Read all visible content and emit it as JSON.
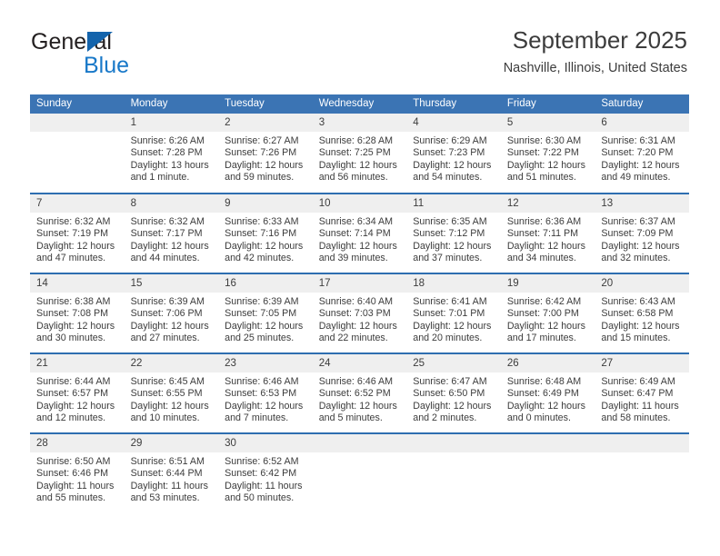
{
  "brand": {
    "word_general": "General",
    "word_blue": "Blue",
    "triangle_color": "#1464ac",
    "blue_text_color": "#1878c8"
  },
  "header": {
    "title": "September 2025",
    "subtitle": "Nashville, Illinois, United States"
  },
  "colors": {
    "header_row_bg": "#3b74b4",
    "row_divider": "#2e6eb0",
    "daynum_bg": "#efefef",
    "text": "#3c3c3c"
  },
  "columns": [
    "Sunday",
    "Monday",
    "Tuesday",
    "Wednesday",
    "Thursday",
    "Friday",
    "Saturday"
  ],
  "weeks": [
    [
      {
        "day": "",
        "blank": true,
        "sunrise": "",
        "sunset": "",
        "daylight_line1": "",
        "daylight_line2": ""
      },
      {
        "day": "1",
        "sunrise": "Sunrise: 6:26 AM",
        "sunset": "Sunset: 7:28 PM",
        "daylight_line1": "Daylight: 13 hours",
        "daylight_line2": "and 1 minute."
      },
      {
        "day": "2",
        "sunrise": "Sunrise: 6:27 AM",
        "sunset": "Sunset: 7:26 PM",
        "daylight_line1": "Daylight: 12 hours",
        "daylight_line2": "and 59 minutes."
      },
      {
        "day": "3",
        "sunrise": "Sunrise: 6:28 AM",
        "sunset": "Sunset: 7:25 PM",
        "daylight_line1": "Daylight: 12 hours",
        "daylight_line2": "and 56 minutes."
      },
      {
        "day": "4",
        "sunrise": "Sunrise: 6:29 AM",
        "sunset": "Sunset: 7:23 PM",
        "daylight_line1": "Daylight: 12 hours",
        "daylight_line2": "and 54 minutes."
      },
      {
        "day": "5",
        "sunrise": "Sunrise: 6:30 AM",
        "sunset": "Sunset: 7:22 PM",
        "daylight_line1": "Daylight: 12 hours",
        "daylight_line2": "and 51 minutes."
      },
      {
        "day": "6",
        "sunrise": "Sunrise: 6:31 AM",
        "sunset": "Sunset: 7:20 PM",
        "daylight_line1": "Daylight: 12 hours",
        "daylight_line2": "and 49 minutes."
      }
    ],
    [
      {
        "day": "7",
        "sunrise": "Sunrise: 6:32 AM",
        "sunset": "Sunset: 7:19 PM",
        "daylight_line1": "Daylight: 12 hours",
        "daylight_line2": "and 47 minutes."
      },
      {
        "day": "8",
        "sunrise": "Sunrise: 6:32 AM",
        "sunset": "Sunset: 7:17 PM",
        "daylight_line1": "Daylight: 12 hours",
        "daylight_line2": "and 44 minutes."
      },
      {
        "day": "9",
        "sunrise": "Sunrise: 6:33 AM",
        "sunset": "Sunset: 7:16 PM",
        "daylight_line1": "Daylight: 12 hours",
        "daylight_line2": "and 42 minutes."
      },
      {
        "day": "10",
        "sunrise": "Sunrise: 6:34 AM",
        "sunset": "Sunset: 7:14 PM",
        "daylight_line1": "Daylight: 12 hours",
        "daylight_line2": "and 39 minutes."
      },
      {
        "day": "11",
        "sunrise": "Sunrise: 6:35 AM",
        "sunset": "Sunset: 7:12 PM",
        "daylight_line1": "Daylight: 12 hours",
        "daylight_line2": "and 37 minutes."
      },
      {
        "day": "12",
        "sunrise": "Sunrise: 6:36 AM",
        "sunset": "Sunset: 7:11 PM",
        "daylight_line1": "Daylight: 12 hours",
        "daylight_line2": "and 34 minutes."
      },
      {
        "day": "13",
        "sunrise": "Sunrise: 6:37 AM",
        "sunset": "Sunset: 7:09 PM",
        "daylight_line1": "Daylight: 12 hours",
        "daylight_line2": "and 32 minutes."
      }
    ],
    [
      {
        "day": "14",
        "sunrise": "Sunrise: 6:38 AM",
        "sunset": "Sunset: 7:08 PM",
        "daylight_line1": "Daylight: 12 hours",
        "daylight_line2": "and 30 minutes."
      },
      {
        "day": "15",
        "sunrise": "Sunrise: 6:39 AM",
        "sunset": "Sunset: 7:06 PM",
        "daylight_line1": "Daylight: 12 hours",
        "daylight_line2": "and 27 minutes."
      },
      {
        "day": "16",
        "sunrise": "Sunrise: 6:39 AM",
        "sunset": "Sunset: 7:05 PM",
        "daylight_line1": "Daylight: 12 hours",
        "daylight_line2": "and 25 minutes."
      },
      {
        "day": "17",
        "sunrise": "Sunrise: 6:40 AM",
        "sunset": "Sunset: 7:03 PM",
        "daylight_line1": "Daylight: 12 hours",
        "daylight_line2": "and 22 minutes."
      },
      {
        "day": "18",
        "sunrise": "Sunrise: 6:41 AM",
        "sunset": "Sunset: 7:01 PM",
        "daylight_line1": "Daylight: 12 hours",
        "daylight_line2": "and 20 minutes."
      },
      {
        "day": "19",
        "sunrise": "Sunrise: 6:42 AM",
        "sunset": "Sunset: 7:00 PM",
        "daylight_line1": "Daylight: 12 hours",
        "daylight_line2": "and 17 minutes."
      },
      {
        "day": "20",
        "sunrise": "Sunrise: 6:43 AM",
        "sunset": "Sunset: 6:58 PM",
        "daylight_line1": "Daylight: 12 hours",
        "daylight_line2": "and 15 minutes."
      }
    ],
    [
      {
        "day": "21",
        "sunrise": "Sunrise: 6:44 AM",
        "sunset": "Sunset: 6:57 PM",
        "daylight_line1": "Daylight: 12 hours",
        "daylight_line2": "and 12 minutes."
      },
      {
        "day": "22",
        "sunrise": "Sunrise: 6:45 AM",
        "sunset": "Sunset: 6:55 PM",
        "daylight_line1": "Daylight: 12 hours",
        "daylight_line2": "and 10 minutes."
      },
      {
        "day": "23",
        "sunrise": "Sunrise: 6:46 AM",
        "sunset": "Sunset: 6:53 PM",
        "daylight_line1": "Daylight: 12 hours",
        "daylight_line2": "and 7 minutes."
      },
      {
        "day": "24",
        "sunrise": "Sunrise: 6:46 AM",
        "sunset": "Sunset: 6:52 PM",
        "daylight_line1": "Daylight: 12 hours",
        "daylight_line2": "and 5 minutes."
      },
      {
        "day": "25",
        "sunrise": "Sunrise: 6:47 AM",
        "sunset": "Sunset: 6:50 PM",
        "daylight_line1": "Daylight: 12 hours",
        "daylight_line2": "and 2 minutes."
      },
      {
        "day": "26",
        "sunrise": "Sunrise: 6:48 AM",
        "sunset": "Sunset: 6:49 PM",
        "daylight_line1": "Daylight: 12 hours",
        "daylight_line2": "and 0 minutes."
      },
      {
        "day": "27",
        "sunrise": "Sunrise: 6:49 AM",
        "sunset": "Sunset: 6:47 PM",
        "daylight_line1": "Daylight: 11 hours",
        "daylight_line2": "and 58 minutes."
      }
    ],
    [
      {
        "day": "28",
        "sunrise": "Sunrise: 6:50 AM",
        "sunset": "Sunset: 6:46 PM",
        "daylight_line1": "Daylight: 11 hours",
        "daylight_line2": "and 55 minutes."
      },
      {
        "day": "29",
        "sunrise": "Sunrise: 6:51 AM",
        "sunset": "Sunset: 6:44 PM",
        "daylight_line1": "Daylight: 11 hours",
        "daylight_line2": "and 53 minutes."
      },
      {
        "day": "30",
        "sunrise": "Sunrise: 6:52 AM",
        "sunset": "Sunset: 6:42 PM",
        "daylight_line1": "Daylight: 11 hours",
        "daylight_line2": "and 50 minutes."
      },
      {
        "day": "",
        "blank": true,
        "sunrise": "",
        "sunset": "",
        "daylight_line1": "",
        "daylight_line2": ""
      },
      {
        "day": "",
        "blank": true,
        "sunrise": "",
        "sunset": "",
        "daylight_line1": "",
        "daylight_line2": ""
      },
      {
        "day": "",
        "blank": true,
        "sunrise": "",
        "sunset": "",
        "daylight_line1": "",
        "daylight_line2": ""
      },
      {
        "day": "",
        "blank": true,
        "sunrise": "",
        "sunset": "",
        "daylight_line1": "",
        "daylight_line2": ""
      }
    ]
  ]
}
